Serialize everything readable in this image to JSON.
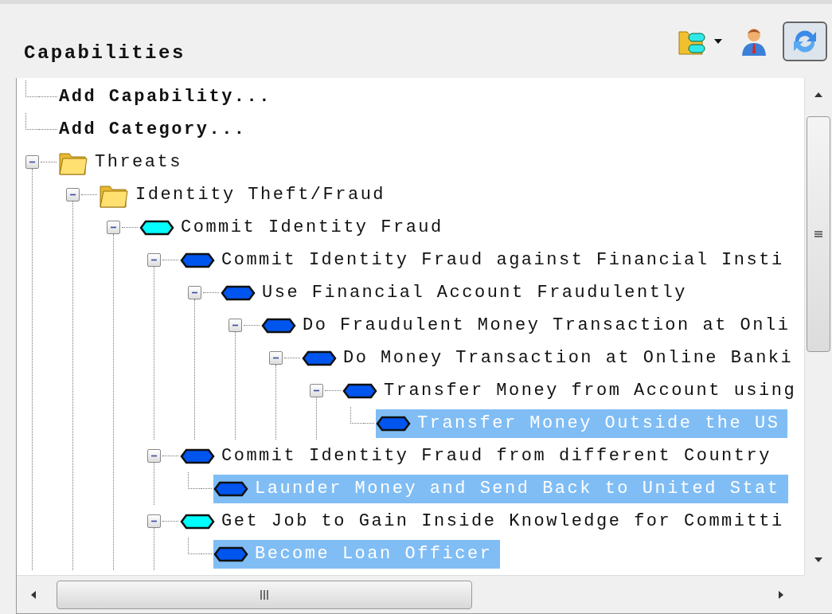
{
  "panel": {
    "title": "Capabilities",
    "toolbar": [
      {
        "kind": "organize",
        "menu": true,
        "pressed": false
      },
      {
        "kind": "user",
        "pressed": false
      },
      {
        "kind": "refresh",
        "pressed": true
      }
    ]
  },
  "tree": [
    {
      "kind": "action",
      "label": "Add Capability...",
      "selected": false
    },
    {
      "kind": "action",
      "label": "Add Category...",
      "selected": false
    },
    {
      "kind": "folder",
      "label": "Threats",
      "expanded": true,
      "selected": false,
      "children": [
        {
          "kind": "folder",
          "label": "Identity Theft/Fraud",
          "expanded": true,
          "selected": false,
          "children": [
            {
              "kind": "capability",
              "label": "Commit Identity Fraud",
              "color": "#00ffff",
              "expanded": true,
              "selected": false,
              "children": [
                {
                  "kind": "capability",
                  "label": "Commit Identity Fraud against Financial Insti",
                  "color": "#0055ee",
                  "expanded": true,
                  "selected": false,
                  "children": [
                    {
                      "kind": "capability",
                      "label": "Use Financial Account Fraudulently",
                      "color": "#0055ee",
                      "expanded": true,
                      "selected": false,
                      "children": [
                        {
                          "kind": "capability",
                          "label": "Do Fraudulent Money Transaction at Onli",
                          "color": "#0055ee",
                          "expanded": true,
                          "selected": false,
                          "children": [
                            {
                              "kind": "capability",
                              "label": "Do Money Transaction at Online Banki",
                              "color": "#0055ee",
                              "expanded": true,
                              "selected": false,
                              "children": [
                                {
                                  "kind": "capability",
                                  "label": "Transfer Money from Account using",
                                  "color": "#0055ee",
                                  "expanded": true,
                                  "selected": false,
                                  "children": [
                                    {
                                      "kind": "capability",
                                      "label": "Transfer Money Outside the US",
                                      "color": "#0055ee",
                                      "selected": true
                                    }
                                  ]
                                }
                              ]
                            }
                          ]
                        }
                      ]
                    }
                  ]
                },
                {
                  "kind": "capability",
                  "label": "Commit Identity Fraud from different Country",
                  "color": "#0055ee",
                  "expanded": true,
                  "selected": false,
                  "children": [
                    {
                      "kind": "capability",
                      "label": "Launder Money and Send Back to United Stat",
                      "color": "#0055ee",
                      "selected": true
                    }
                  ]
                },
                {
                  "kind": "capability",
                  "label": "Get Job to Gain Inside Knowledge for Committi",
                  "color": "#00ffff",
                  "expanded": true,
                  "selected": false,
                  "children": [
                    {
                      "kind": "capability",
                      "label": "Become Loan Officer",
                      "color": "#0055ee",
                      "selected": true
                    }
                  ]
                }
              ]
            }
          ]
        }
      ]
    }
  ]
}
